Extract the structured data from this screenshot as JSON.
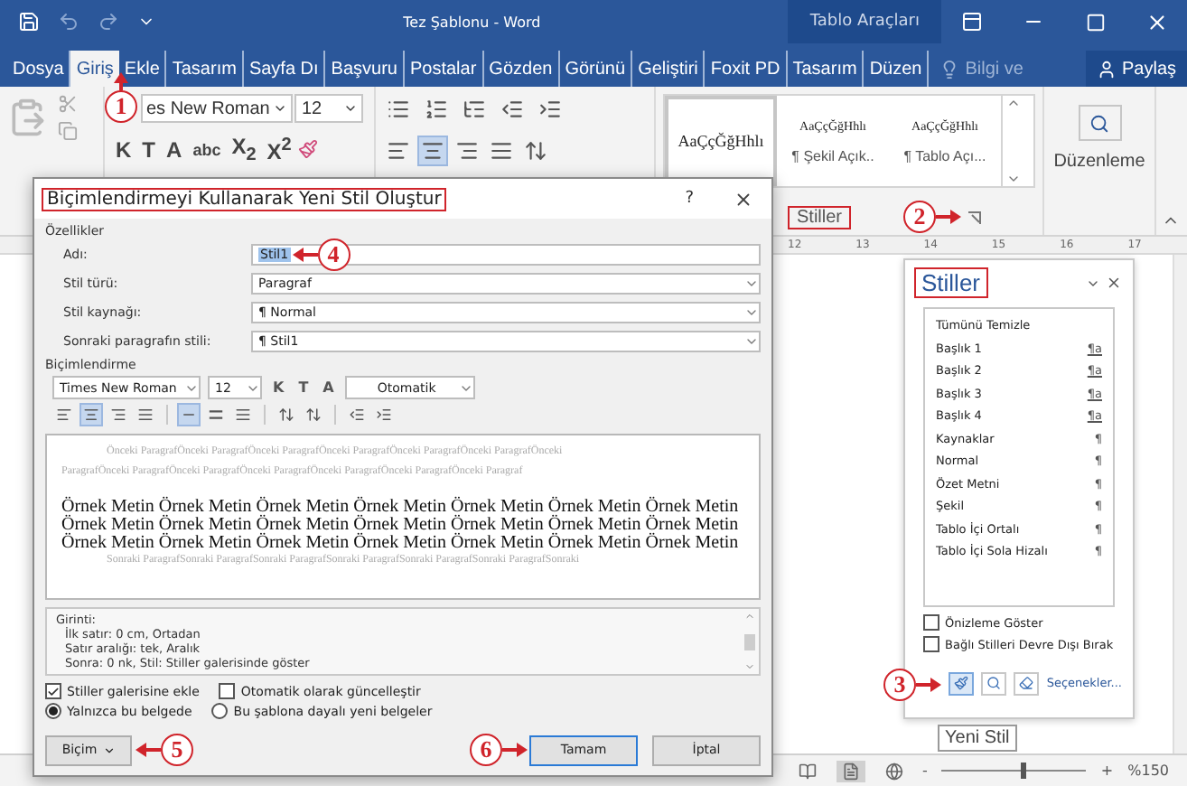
{
  "window": {
    "title": "Tez Şablonu - Word",
    "context_tab": "Tablo Araçları"
  },
  "ribbon_tabs": [
    {
      "label": "Dosya",
      "selected": false
    },
    {
      "label": "Giriş",
      "selected": true
    },
    {
      "label": "Ekle",
      "selected": false
    },
    {
      "label": "Tasarım",
      "selected": false
    },
    {
      "label": "Sayfa Dı",
      "selected": false
    },
    {
      "label": "Başvuru",
      "selected": false
    },
    {
      "label": "Postalar",
      "selected": false
    },
    {
      "label": "Gözden",
      "selected": false
    },
    {
      "label": "Görünü",
      "selected": false
    },
    {
      "label": "Geliştiri",
      "selected": false
    },
    {
      "label": "Foxit PD",
      "selected": false
    },
    {
      "label": "Tasarım",
      "selected": false
    },
    {
      "label": "Düzen",
      "selected": false
    }
  ],
  "tell_me": {
    "placeholder": "Bilgi ve"
  },
  "share": {
    "label": "Paylaş"
  },
  "ribbon": {
    "callout": {
      "number": "1",
      "kind": "up"
    },
    "font_name": "es New Roman",
    "font_size": "12",
    "font_buttons": [
      "K",
      "T",
      "A",
      "abc",
      "X$_{2}$",
      "X$^{2}$"
    ],
    "paragraph_align": [
      {
        "kind": "left",
        "selected": false
      },
      {
        "kind": "center",
        "selected": true
      },
      {
        "kind": "right",
        "selected": false
      },
      {
        "kind": "justify",
        "selected": false
      }
    ],
    "style_gallery": [
      {
        "sample": "AaÇçĞğHhlı",
        "selected": true
      },
      {
        "sample": "AaÇçĞğHhlı",
        "name": "¶ Şekil Açık..",
        "selected": false
      },
      {
        "sample": "AaÇçĞğHhlı",
        "name": "¶ Tablo Açı...",
        "selected": false
      }
    ],
    "styles_group": {
      "label": "Stiller",
      "highlighted": true,
      "callout": {
        "number": "2",
        "kind": "right"
      }
    },
    "editing": {
      "label": "Düzenleme"
    }
  },
  "ruler": [
    "12",
    "13",
    "14",
    "15",
    "16",
    "17"
  ],
  "dialog": {
    "title": "Biçimlendirmeyi Kullanarak Yeni Stil Oluştur",
    "title_highlighted": true,
    "help": "?",
    "properties_label": "Özellikler",
    "fields": [
      {
        "label": "Adı:",
        "value": "Stil1",
        "kind": "text",
        "callout": {
          "number": "4",
          "kind": "left"
        }
      },
      {
        "label": "Stil türü:",
        "value": "Paragraf",
        "kind": "select"
      },
      {
        "label": "Stil kaynağı:",
        "value": "¶ Normal",
        "kind": "select"
      },
      {
        "label": "Sonraki paragrafın stili:",
        "value": "¶ Stil1",
        "kind": "select"
      }
    ],
    "formatting_label": "Biçimlendirme",
    "font": "Times New Roman",
    "size": "12",
    "format_buttons": [
      "K",
      "T",
      "A"
    ],
    "font_color": "Otomatik",
    "align": [
      {
        "kind": "left",
        "selected": false
      },
      {
        "kind": "center",
        "selected": true
      },
      {
        "kind": "right",
        "selected": false
      },
      {
        "kind": "justify",
        "selected": false
      }
    ],
    "spacing": [
      {
        "kind": "single",
        "selected": true
      },
      {
        "kind": "onehalf",
        "selected": false
      },
      {
        "kind": "double",
        "selected": false
      }
    ],
    "preview_before": [
      "Önceki ParagrafÖnceki ParagrafÖnceki ParagrafÖnceki ParagrafÖnceki ParagrafÖnceki ParagrafÖnceki",
      "ParagrafÖnceki ParagrafÖnceki ParagrafÖnceki ParagrafÖnceki ParagrafÖnceki ParagrafÖnceki Paragraf"
    ],
    "preview_sample": [
      "Örnek Metin Örnek Metin Örnek Metin Örnek Metin Örnek Metin Örnek Metin Örnek Metin",
      "Örnek Metin Örnek Metin Örnek Metin Örnek Metin Örnek Metin Örnek Metin Örnek Metin",
      "Örnek Metin Örnek Metin Örnek Metin Örnek Metin Örnek Metin Örnek Metin Örnek Metin"
    ],
    "preview_after": [
      "Sonraki ParagrafSonraki ParagrafSonraki ParagrafSonraki ParagrafSonraki ParagrafSonraki ParagrafSonraki"
    ],
    "description": [
      "Girinti:",
      "İlk satır: 0 cm, Ortadan",
      "Satır aralığı: tek, Aralık",
      "Sonra: 0 nk, Stil: Stiller galerisinde göster"
    ],
    "checkboxes": [
      {
        "label": "Stiller galerisine ekle",
        "checked": true
      },
      {
        "label": "Otomatik olarak güncelleştir",
        "checked": false
      }
    ],
    "radios": [
      {
        "label": "Yalnızca bu belgede",
        "selected": true
      },
      {
        "label": "Bu şablona dayalı yeni belgeler",
        "selected": false
      }
    ],
    "format_button": {
      "label": "Biçim",
      "callout": {
        "number": "5",
        "kind": "left"
      }
    },
    "ok_button": {
      "label": "Tamam",
      "callout": {
        "number": "6",
        "kind": "right"
      }
    },
    "cancel_button": {
      "label": "İptal"
    }
  },
  "styles_pane": {
    "title": "Stiller",
    "title_highlighted": true,
    "items": [
      {
        "name": "Tümünü Temizle",
        "kind": "clear"
      },
      {
        "name": "Başlık 1",
        "kind": "linked",
        "symbol": "¶a"
      },
      {
        "name": "Başlık 2",
        "kind": "linked",
        "symbol": "¶a"
      },
      {
        "name": "Başlık 3",
        "kind": "linked",
        "symbol": "¶a"
      },
      {
        "name": "Başlık 4",
        "kind": "linked",
        "symbol": "¶a"
      },
      {
        "name": "Kaynaklar",
        "kind": "paragraph",
        "symbol": "¶"
      },
      {
        "name": "Normal",
        "kind": "paragraph",
        "symbol": "¶"
      },
      {
        "name": "Özet Metni",
        "kind": "paragraph",
        "symbol": "¶"
      },
      {
        "name": "Şekil",
        "kind": "paragraph",
        "symbol": "¶"
      },
      {
        "name": "Tablo İçi Ortalı",
        "kind": "paragraph",
        "symbol": "¶"
      },
      {
        "name": "Tablo İçi Sola Hizalı",
        "kind": "paragraph",
        "symbol": "¶"
      }
    ],
    "checkboxes": [
      {
        "label": "Önizleme Göster",
        "checked": false
      },
      {
        "label": "Bağlı Stilleri Devre Dışı Bırak",
        "checked": false
      }
    ],
    "callout": {
      "number": "3",
      "kind": "right"
    },
    "options_link": "Seçenekler...",
    "tooltip": "Yeni Stil"
  },
  "status_bar": {
    "views": [
      {
        "kind": "read",
        "selected": false
      },
      {
        "kind": "print",
        "selected": true
      },
      {
        "kind": "web",
        "selected": false
      }
    ],
    "zoom_minus": "-",
    "zoom_plus": "+",
    "level": 0.55,
    "zoom": "%150"
  }
}
